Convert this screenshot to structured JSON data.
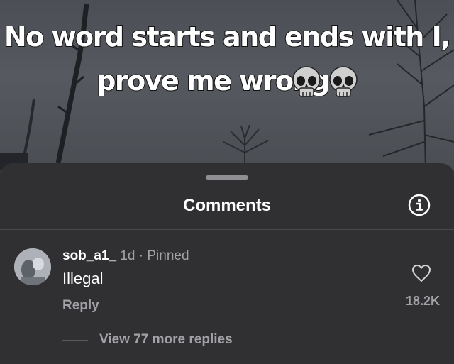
{
  "video": {
    "caption_line1": "No word starts and ends with I,",
    "caption_line2": "prove me wrong",
    "caption_emoji": [
      "skull-icon",
      "skull-icon"
    ]
  },
  "comments_sheet": {
    "title": "Comments",
    "info_icon": "info-icon",
    "comment": {
      "username": "sob_a1_",
      "age": "1d",
      "separator": "·",
      "pinned_label": "Pinned",
      "text": "Illegal",
      "reply_label": "Reply",
      "like_icon": "heart-outline-icon",
      "like_count": "18.2K",
      "view_replies_label": "View 77 more replies"
    }
  },
  "colors": {
    "sheet_background": "#303032",
    "primary_text": "#ffffff",
    "secondary_text": "#a1a1a6"
  }
}
